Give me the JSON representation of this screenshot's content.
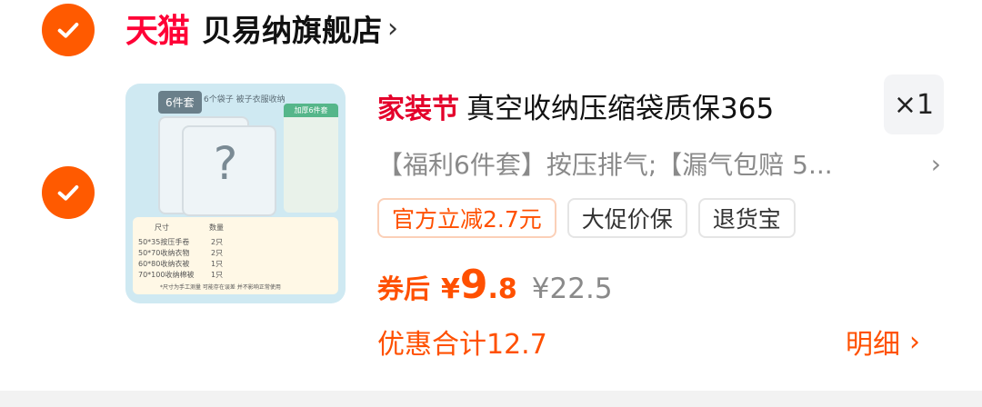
{
  "store": {
    "mall_logo_text": "天猫",
    "name": "贝易纳旗舰店",
    "chevron": "›"
  },
  "item": {
    "promo_tag": "家装节",
    "title": "真空收纳压缩袋质保365",
    "quantity": "×1",
    "spec": "【福利6件套】按压排气;【漏气包赔 5...",
    "spec_chevron": "›",
    "thumbnail": {
      "tag": "6件套",
      "subtitle": "6个袋子 被子衣服收纳",
      "green_header": "加厚6件套",
      "table_header_size": "尺寸",
      "table_header_qty": "数量",
      "rows": [
        {
          "size": "50*35按压手卷",
          "qty": "2只"
        },
        {
          "size": "50*70收纳衣物",
          "qty": "2只"
        },
        {
          "size": "60*80收纳衣被",
          "qty": "1只"
        },
        {
          "size": "70*100收纳棉被",
          "qty": "1只"
        }
      ],
      "footnote": "*尺寸为手工测量 可能存在误差 并不影响正常使用"
    },
    "chips": [
      {
        "label": "官方立减2.7元",
        "style": "orange"
      },
      {
        "label": "大促价保",
        "style": "gray"
      },
      {
        "label": "退货宝",
        "style": "gray"
      }
    ],
    "price": {
      "label": "券后",
      "currency": "¥",
      "integer": "9",
      "decimal": ".8",
      "original": "¥22.5"
    },
    "discount_total": "优惠合计12.7",
    "detail_label": "明细",
    "detail_chevron": "›"
  },
  "colors": {
    "accent": "#ff5000",
    "check": "#ff5a00",
    "tmall": "#ff0036",
    "promo": "#e4002b"
  },
  "icons": {
    "check": "checkmark-circle-icon",
    "chevron": "chevron-right-icon"
  }
}
